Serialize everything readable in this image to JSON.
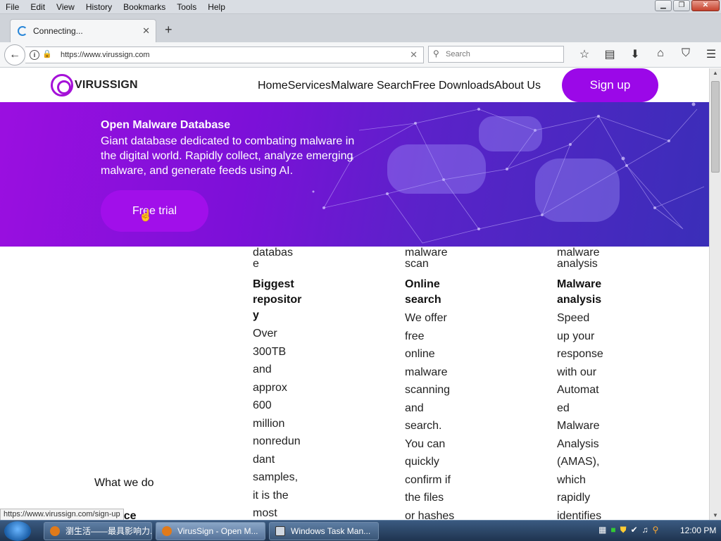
{
  "menubar": {
    "items": [
      "File",
      "Edit",
      "View",
      "History",
      "Bookmarks",
      "Tools",
      "Help"
    ]
  },
  "tab": {
    "title": "Connecting..."
  },
  "navbar": {
    "url": "https://www.virussign.com",
    "search_placeholder": "Search"
  },
  "site": {
    "brand": "VIRUSSIGN",
    "nav": [
      "Home",
      "Services",
      "Malware Search",
      "Free Downloads",
      "About Us"
    ],
    "signup_label": "Sign up",
    "accent_color": "#9b08e8"
  },
  "hero": {
    "title": "Open Malware Database",
    "text": "Giant database dedicated to combating malware in the digital world. Rapidly collect, analyze emerging malware, and generate feeds using AI.",
    "button_label": "Free trial"
  },
  "columns": [
    {
      "top_fragment": "databas\ne",
      "title": "Biggest\nrepositor\ny",
      "body": "Over\n300TB\nand\napprox\n600\nmillion\nnonredun\ndant\nsamples,\nit is the\nmost"
    },
    {
      "top_fragment": "malware\nscan",
      "title": "Online\nsearch",
      "body": "We offer\nfree\nonline\nmalware\nscanning\nand\nsearch.\nYou can\nquickly\nconfirm if\nthe files\nor hashes"
    },
    {
      "top_fragment": "malware\nanalysis",
      "title": "Malware\nanalysis",
      "body": "Speed\nup your\nresponse\nwith our\nAutomat\ned\nMalware\nAnalysis\n(AMAS),\nwhich\nrapidly\nidentifies"
    }
  ],
  "section": {
    "what_we_do": "What we do",
    "intelligence_fragment": "lligence"
  },
  "status_url": "https://www.virussign.com/sign-up",
  "taskbar": {
    "items": [
      "瀏生活——最具影响力...",
      "VirusSign - Open M...",
      "Windows Task Man..."
    ],
    "clock": "12:00 PM"
  }
}
